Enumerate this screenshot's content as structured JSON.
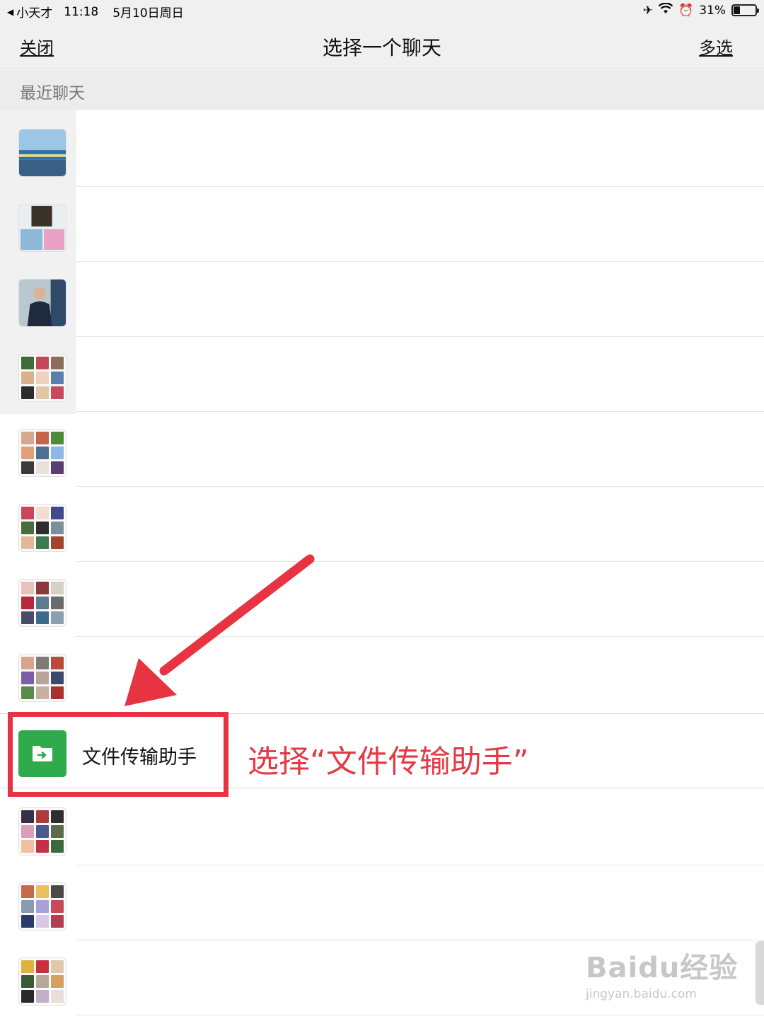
{
  "status_bar": {
    "carrier": "小天才",
    "time": "11:18",
    "date": "5月10日周日",
    "battery": "31%",
    "battery_level": 0.31,
    "icons": [
      "back-arrow-icon",
      "airplane-icon",
      "wifi-icon",
      "alarm-icon",
      "battery-icon"
    ]
  },
  "nav": {
    "close_label": "关闭",
    "title": "选择一个聊天",
    "multi_select_label": "多选"
  },
  "section": {
    "recent_label": "最近聊天"
  },
  "file_transfer": {
    "name": "文件传输助手",
    "icon": "folder-arrow-icon",
    "icon_color": "#2faa4c"
  },
  "annotation": {
    "text": "选择“文件传输助手”",
    "color": "#e83342"
  },
  "watermark": {
    "brand": "Baidu经验",
    "url": "jingyan.baidu.com"
  }
}
